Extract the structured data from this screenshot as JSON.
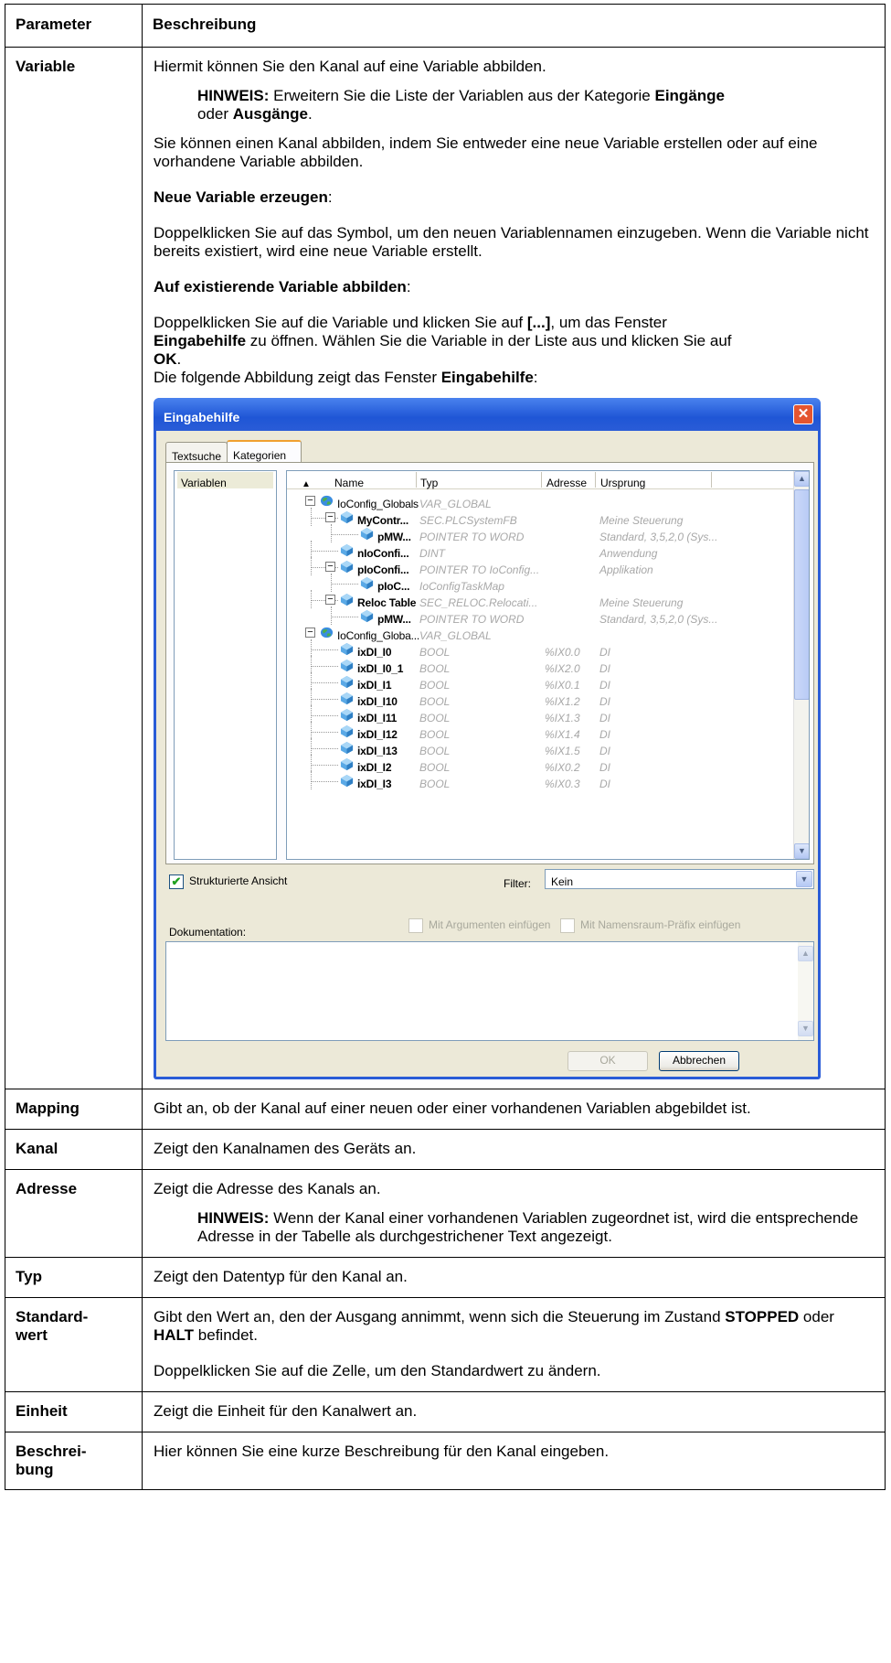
{
  "table": {
    "header": {
      "parameter": "Parameter",
      "description": "Beschreibung"
    },
    "variable": {
      "name": "Variable",
      "intro": "Hiermit können Sie den Kanal auf eine Variable abbilden.",
      "note_label": "HINWEIS:",
      "note_text_1": " Erweitern Sie die Liste der Variablen aus der Kategorie ",
      "note_bold_1": "Eingänge",
      "note_text_2": " oder ",
      "note_bold_2": "Ausgänge",
      "note_text_3": ".",
      "para2": "Sie können einen Kanal abbilden, indem Sie entweder eine neue Variable erstellen oder auf eine vorhandene Variable abbilden.",
      "new_heading": "Neue Variable erzeugen",
      "colon": ":",
      "new_text": "Doppelklicken Sie auf das Symbol, um den neuen Variablennamen einzugeben. Wenn die Variable nicht bereits existiert, wird eine neue Variable erstellt.",
      "existing_heading": "Auf existierende Variable abbilden",
      "existing_text_1": "Doppelklicken Sie auf die Variable und klicken Sie auf ",
      "existing_bold_1": "[...]",
      "existing_text_2": ", um das Fenster ",
      "existing_bold_2": "Eingabehilfe",
      "existing_text_3": " zu öffnen. Wählen Sie die Variable in der Liste aus und klicken Sie auf ",
      "existing_bold_3": "OK",
      "existing_text_4": ".",
      "figure_text": "Die folgende Abbildung zeigt das Fenster ",
      "figure_bold": "Eingabehilfe",
      "figure_colon": ":"
    },
    "mapping": {
      "name": "Mapping",
      "text": "Gibt an, ob der Kanal auf einer neuen oder einer vorhandenen Variablen abgebildet ist."
    },
    "kanal": {
      "name": "Kanal",
      "text": "Zeigt den Kanalnamen des Geräts an."
    },
    "adresse": {
      "name": "Adresse",
      "text": "Zeigt die Adresse des Kanals an.",
      "note_label": "HINWEIS:",
      "note_text": " Wenn der Kanal einer vorhandenen Variablen zugeordnet ist, wird die entsprechende Adresse in der Tabelle als durchgestrichener Text angezeigt."
    },
    "typ": {
      "name": "Typ",
      "text": "Zeigt den Datentyp für den Kanal an."
    },
    "standardwert": {
      "name_1": "Standard-",
      "name_2": "wert",
      "text_1": "Gibt den Wert an, den der Ausgang annimmt, wenn sich die Steuerung im Zustand ",
      "bold_1": "STOPPED",
      "text_2": " oder ",
      "bold_2": "HALT",
      "text_3": " befindet.",
      "text_4": "Doppelklicken Sie auf die Zelle, um den Standardwert zu ändern."
    },
    "einheit": {
      "name": "Einheit",
      "text": "Zeigt die Einheit für den Kanalwert an."
    },
    "beschreibung": {
      "name_1": "Beschrei-",
      "name_2": "bung",
      "text": "Hier können Sie eine kurze Beschreibung für den Kanal eingeben."
    }
  },
  "dialog": {
    "title": "Eingabehilfe",
    "close_glyph": "✕",
    "tabs": [
      "Textsuche",
      "Kategorien"
    ],
    "categories": [
      "Variablen"
    ],
    "columns": {
      "sort_glyph": "▲",
      "name": "Name",
      "type": "Typ",
      "address": "Adresse",
      "origin": "Ursprung"
    },
    "rows": [
      {
        "name": "IoConfig_Globals",
        "type": "VAR_GLOBAL",
        "address": "",
        "origin": "",
        "level": 0,
        "bold": false,
        "expander": "−",
        "icon": "globe-icon"
      },
      {
        "name": "MyContr...",
        "type": "SEC.PLCSystemFB",
        "address": "",
        "origin": "Meine Steuerung",
        "level": 1,
        "bold": true,
        "expander": "−",
        "icon": "variable-icon"
      },
      {
        "name": "pMW...",
        "type": "POINTER TO WORD",
        "address": "",
        "origin": "Standard, 3,5,2,0 (Sys...",
        "level": 2,
        "bold": true,
        "expander": "",
        "icon": "variable-icon"
      },
      {
        "name": "nIoConfi...",
        "type": "DINT",
        "address": "",
        "origin": "Anwendung",
        "level": 1,
        "bold": true,
        "expander": "",
        "icon": "variable-icon"
      },
      {
        "name": "pIoConfi...",
        "type": "POINTER TO IoConfig...",
        "address": "",
        "origin": "Applikation",
        "level": 1,
        "bold": true,
        "expander": "−",
        "icon": "variable-icon"
      },
      {
        "name": "pIoC...",
        "type": "IoConfigTaskMap",
        "address": "",
        "origin": "",
        "level": 2,
        "bold": true,
        "expander": "",
        "icon": "variable-icon"
      },
      {
        "name": "Reloc Table",
        "type": "SEC_RELOC.Relocati...",
        "address": "",
        "origin": "Meine Steuerung",
        "level": 1,
        "bold": true,
        "expander": "−",
        "icon": "variable-icon"
      },
      {
        "name": "pMW...",
        "type": "POINTER TO WORD",
        "address": "",
        "origin": "Standard, 3,5,2,0 (Sys...",
        "level": 2,
        "bold": true,
        "expander": "",
        "icon": "variable-icon"
      },
      {
        "name": "IoConfig_Globa...",
        "type": "VAR_GLOBAL",
        "address": "",
        "origin": "",
        "level": 0,
        "bold": false,
        "expander": "−",
        "icon": "globe-icon"
      },
      {
        "name": "ixDI_I0",
        "type": "BOOL",
        "address": "%IX0.0",
        "origin": "DI",
        "level": 1,
        "bold": true,
        "expander": "",
        "icon": "variable-icon"
      },
      {
        "name": "ixDI_I0_1",
        "type": "BOOL",
        "address": "%IX2.0",
        "origin": "DI",
        "level": 1,
        "bold": true,
        "expander": "",
        "icon": "variable-icon"
      },
      {
        "name": "ixDI_I1",
        "type": "BOOL",
        "address": "%IX0.1",
        "origin": "DI",
        "level": 1,
        "bold": true,
        "expander": "",
        "icon": "variable-icon"
      },
      {
        "name": "ixDI_I10",
        "type": "BOOL",
        "address": "%IX1.2",
        "origin": "DI",
        "level": 1,
        "bold": true,
        "expander": "",
        "icon": "variable-icon"
      },
      {
        "name": "ixDI_I11",
        "type": "BOOL",
        "address": "%IX1.3",
        "origin": "DI",
        "level": 1,
        "bold": true,
        "expander": "",
        "icon": "variable-icon"
      },
      {
        "name": "ixDI_I12",
        "type": "BOOL",
        "address": "%IX1.4",
        "origin": "DI",
        "level": 1,
        "bold": true,
        "expander": "",
        "icon": "variable-icon"
      },
      {
        "name": "ixDI_I13",
        "type": "BOOL",
        "address": "%IX1.5",
        "origin": "DI",
        "level": 1,
        "bold": true,
        "expander": "",
        "icon": "variable-icon"
      },
      {
        "name": "ixDI_I2",
        "type": "BOOL",
        "address": "%IX0.2",
        "origin": "DI",
        "level": 1,
        "bold": true,
        "expander": "",
        "icon": "variable-icon"
      },
      {
        "name": "ixDI_I3",
        "type": "BOOL",
        "address": "%IX0.3",
        "origin": "DI",
        "level": 1,
        "bold": true,
        "expander": "",
        "icon": "variable-icon"
      }
    ],
    "structured_view": {
      "label": "Strukturierte Ansicht",
      "checked": true,
      "check_glyph": "✔"
    },
    "filter": {
      "label": "Filter:",
      "value": "Kein",
      "dropdown_glyph": "▼"
    },
    "documentation_label": "Dokumentation:",
    "insert_with_arguments": "Mit Argumenten einfügen",
    "insert_with_namespace": "Mit Namensraum-Präfix einfügen",
    "scroll_up_glyph": "▲",
    "scroll_down_glyph": "▼",
    "ok_label": "OK",
    "cancel_label": "Abbrechen"
  }
}
